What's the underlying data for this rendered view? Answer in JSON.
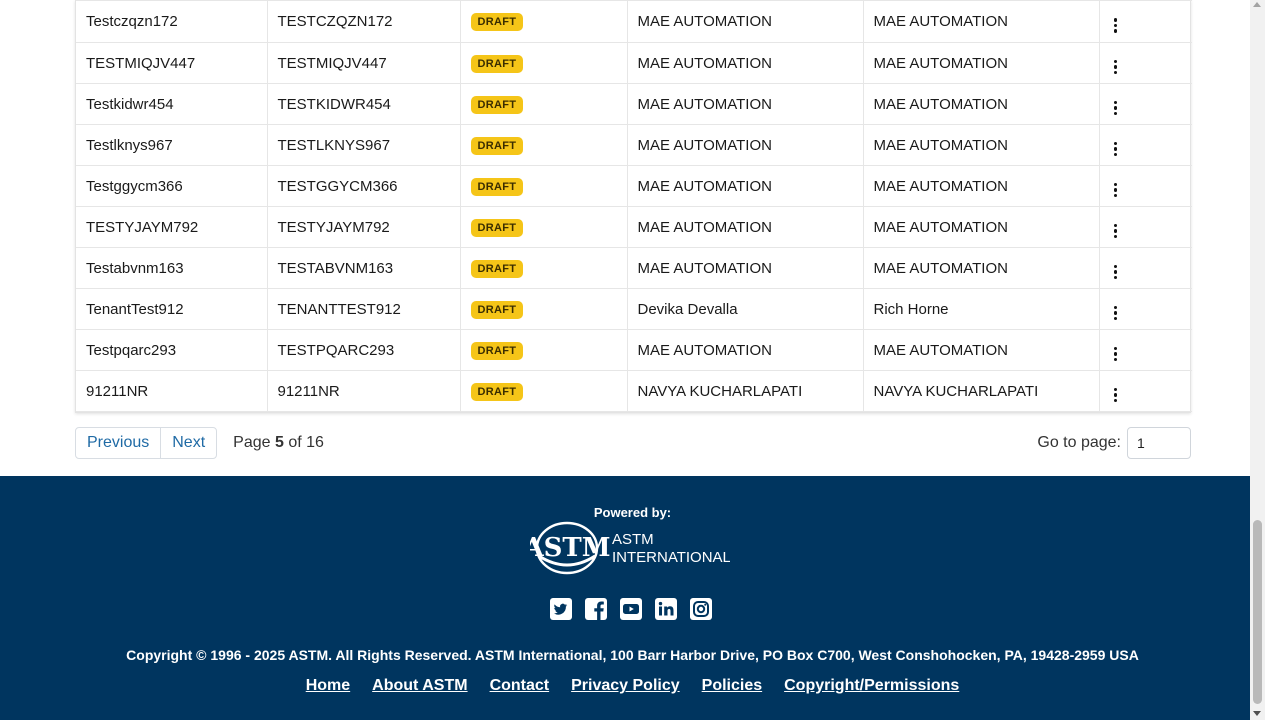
{
  "table": {
    "rows": [
      {
        "name": "Testczqzn172",
        "code": "TESTCZQZN172",
        "status": "DRAFT",
        "created_by": "MAE AUTOMATION",
        "owner": "MAE AUTOMATION"
      },
      {
        "name": "TESTMIQJV447",
        "code": "TESTMIQJV447",
        "status": "DRAFT",
        "created_by": "MAE AUTOMATION",
        "owner": "MAE AUTOMATION"
      },
      {
        "name": "Testkidwr454",
        "code": "TESTKIDWR454",
        "status": "DRAFT",
        "created_by": "MAE AUTOMATION",
        "owner": "MAE AUTOMATION"
      },
      {
        "name": "Testlknys967",
        "code": "TESTLKNYS967",
        "status": "DRAFT",
        "created_by": "MAE AUTOMATION",
        "owner": "MAE AUTOMATION"
      },
      {
        "name": "Testggycm366",
        "code": "TESTGGYCM366",
        "status": "DRAFT",
        "created_by": "MAE AUTOMATION",
        "owner": "MAE AUTOMATION"
      },
      {
        "name": "TESTYJAYM792",
        "code": "TESTYJAYM792",
        "status": "DRAFT",
        "created_by": "MAE AUTOMATION",
        "owner": "MAE AUTOMATION"
      },
      {
        "name": "Testabvnm163",
        "code": "TESTABVNM163",
        "status": "DRAFT",
        "created_by": "MAE AUTOMATION",
        "owner": "MAE AUTOMATION"
      },
      {
        "name": "TenantTest912",
        "code": "TENANTTEST912",
        "status": "DRAFT",
        "created_by": "Devika Devalla",
        "owner": "Rich Horne"
      },
      {
        "name": "Testpqarc293",
        "code": "TESTPQARC293",
        "status": "DRAFT",
        "created_by": "MAE AUTOMATION",
        "owner": "MAE AUTOMATION"
      },
      {
        "name": "91211NR",
        "code": "91211NR",
        "status": "DRAFT",
        "created_by": "NAVYA KUCHARLAPATI",
        "owner": "NAVYA KUCHARLAPATI"
      }
    ],
    "actions_icon": "kebab-menu-icon"
  },
  "pagination": {
    "previous_label": "Previous",
    "next_label": "Next",
    "page_prefix": "Page",
    "current_page": "5",
    "page_of": "of 16",
    "goto_label": "Go to page:",
    "goto_value": "1"
  },
  "footer": {
    "powered_by": "Powered by:",
    "logo_text_1": "ASTM",
    "logo_text_2": "INTERNATIONAL",
    "logo_mark_text": "ASTM",
    "socials": [
      "twitter-icon",
      "facebook-icon",
      "youtube-icon",
      "linkedin-icon",
      "instagram-icon"
    ],
    "copyright": "Copyright © 1996 - 2025 ASTM. All Rights Reserved. ASTM International, 100 Barr Harbor Drive, PO Box C700, West Conshohocken, PA, 19428-2959 USA",
    "links": [
      "Home",
      "About ASTM",
      "Contact",
      "Privacy Policy",
      "Policies",
      "Copyright/Permissions"
    ]
  },
  "colors": {
    "footer_bg": "#00355f",
    "badge_bg": "#f5c518",
    "link": "#1f6aa5"
  }
}
